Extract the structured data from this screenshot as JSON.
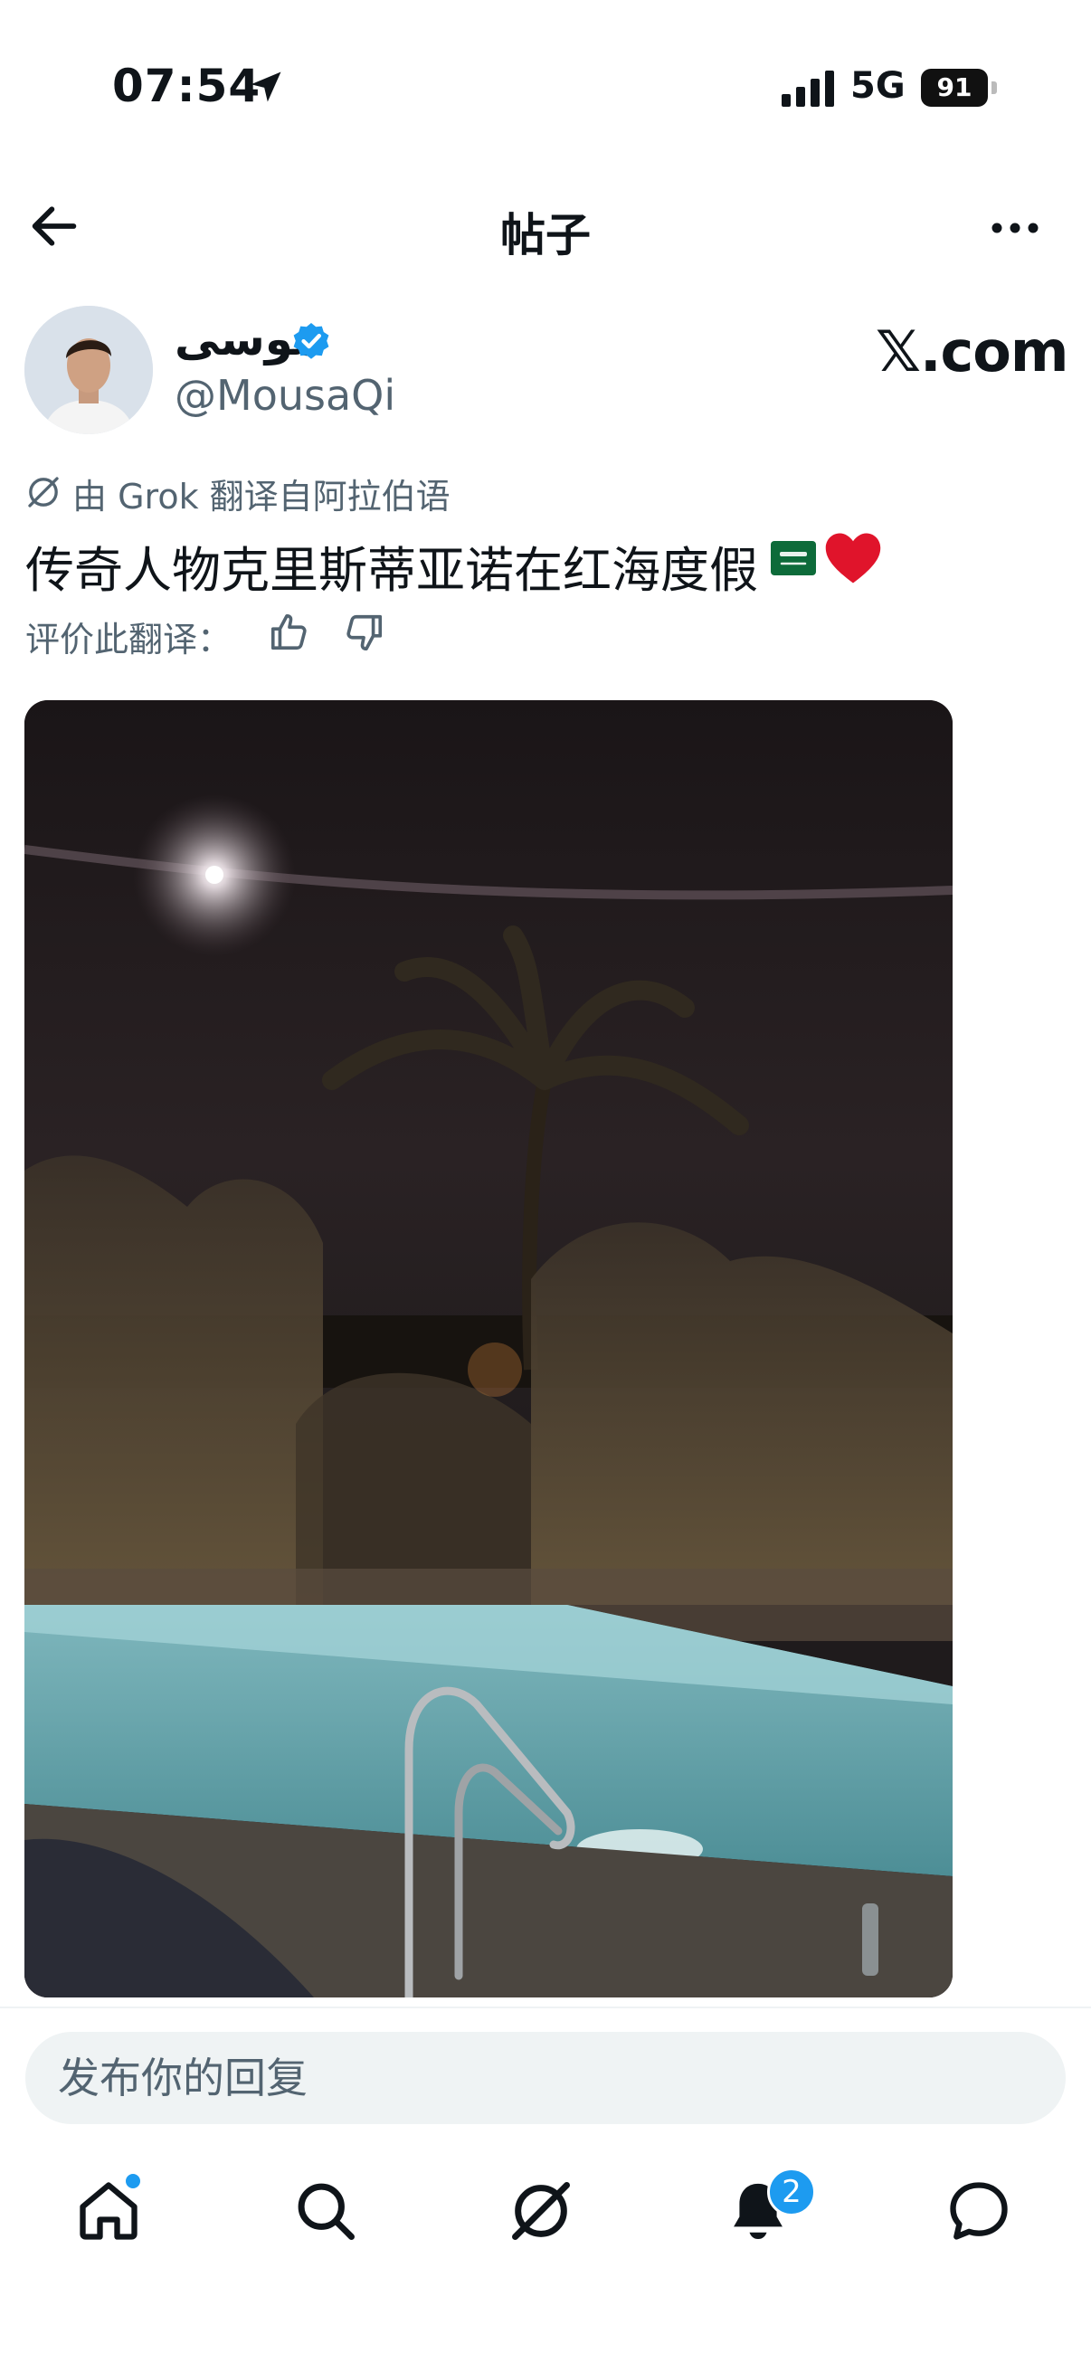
{
  "status_bar": {
    "time": "07:54",
    "network": "5G",
    "battery": "91"
  },
  "header": {
    "title": "帖子"
  },
  "author": {
    "name": "موسى",
    "handle": "@MousaQi",
    "verified": true
  },
  "watermark": "𝕏.com",
  "translation": {
    "label": "由 Grok 翻译自阿拉伯语",
    "text": "传奇人物克里斯蒂亚诺在红海度假",
    "rate_label": "评价此翻译："
  },
  "reply": {
    "placeholder": "发布你的回复"
  },
  "tab_bar": {
    "notifications_count": "2",
    "items": [
      "home-icon",
      "search-icon",
      "grok-icon",
      "bell-icon",
      "chat-bubble-icon"
    ]
  },
  "colors": {
    "accent": "#1d9bf0",
    "secondary_text": "#536471",
    "input_bg": "#eff3f4"
  }
}
